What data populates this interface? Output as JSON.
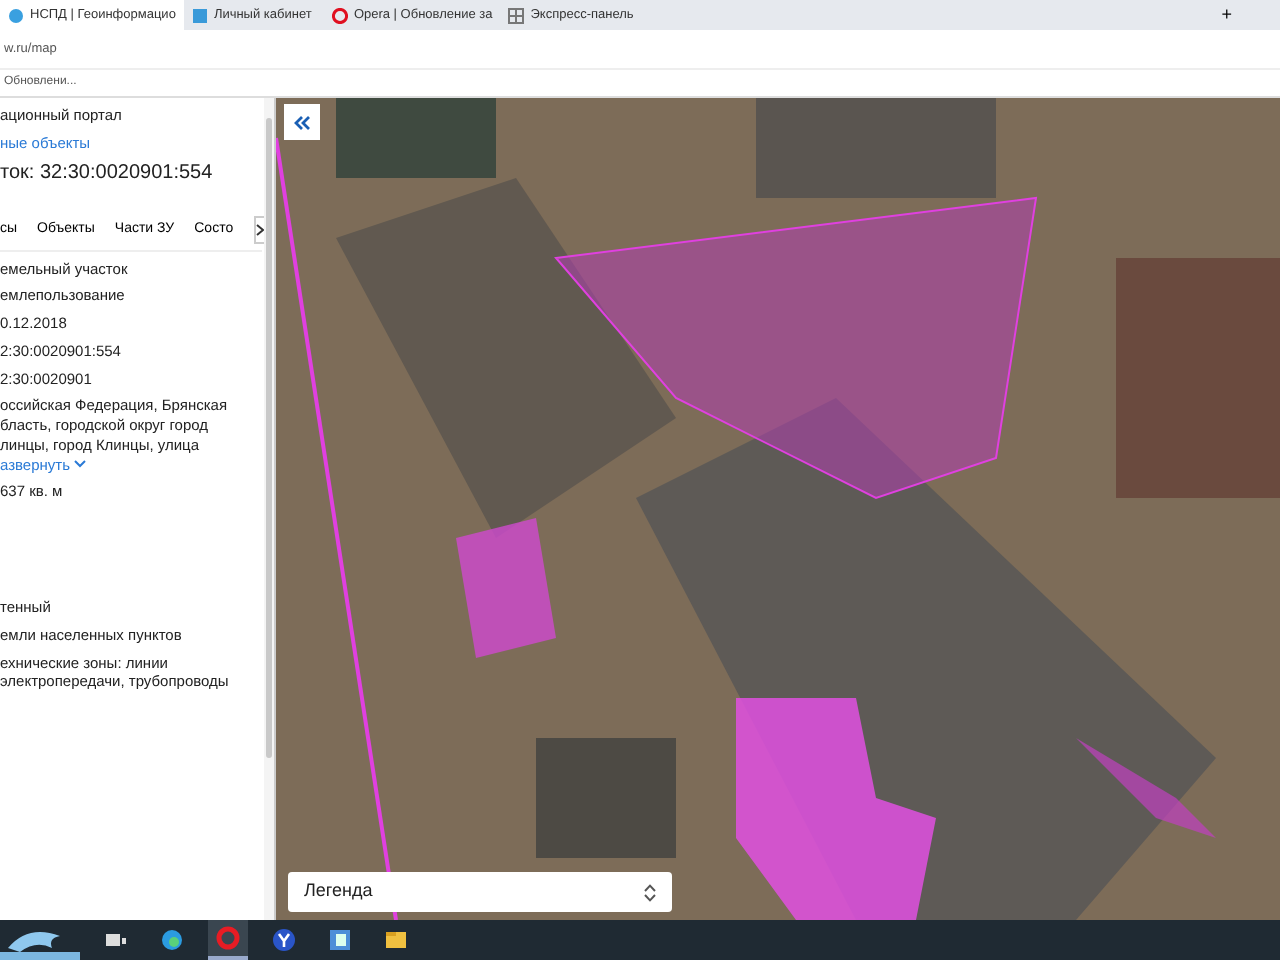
{
  "browser": {
    "tabs": [
      {
        "label": "НСПД | Геоинформацио",
        "selected": true
      },
      {
        "label": "Личный кабинет",
        "selected": false
      },
      {
        "label": "Opera | Обновление за",
        "selected": false
      },
      {
        "label": "Экспресс-панель",
        "selected": false
      }
    ],
    "new_tab": "+",
    "address": "w.ru/map",
    "bookmark": "Обновлени..."
  },
  "panel": {
    "portal": "ационный портал",
    "link": "ные объекты",
    "title": "ток: 32:30:0020901:554",
    "tabs": [
      "сы",
      "Объекты",
      "Части ЗУ",
      "Состо"
    ],
    "fields": [
      {
        "kind": "text",
        "value": "емельный участок"
      },
      {
        "kind": "text",
        "value": "емлепользование"
      },
      {
        "kind": "text",
        "value": "0.12.2018"
      },
      {
        "kind": "text",
        "value": "2:30:0020901:554"
      },
      {
        "kind": "text",
        "value": "2:30:0020901"
      },
      {
        "kind": "address",
        "value": "оссийская Федерация, Брянская бласть, городской округ город линцы, город Клинцы, улица",
        "expand": "азвернуть"
      },
      {
        "kind": "text",
        "value": "637 кв. м"
      },
      {
        "kind": "gap"
      },
      {
        "kind": "text",
        "value": "тенный"
      },
      {
        "kind": "text",
        "value": "емли населенных пунктов"
      },
      {
        "kind": "text",
        "value": "ехнические зоны: линии электропередачи, трубопроводы"
      }
    ]
  },
  "map": {
    "legend": "Легенда"
  },
  "taskbar": {
    "apps": [
      {
        "selected": false
      },
      {
        "selected": false
      },
      {
        "selected": true
      },
      {
        "selected": false
      },
      {
        "selected": false
      },
      {
        "selected": false
      }
    ]
  }
}
